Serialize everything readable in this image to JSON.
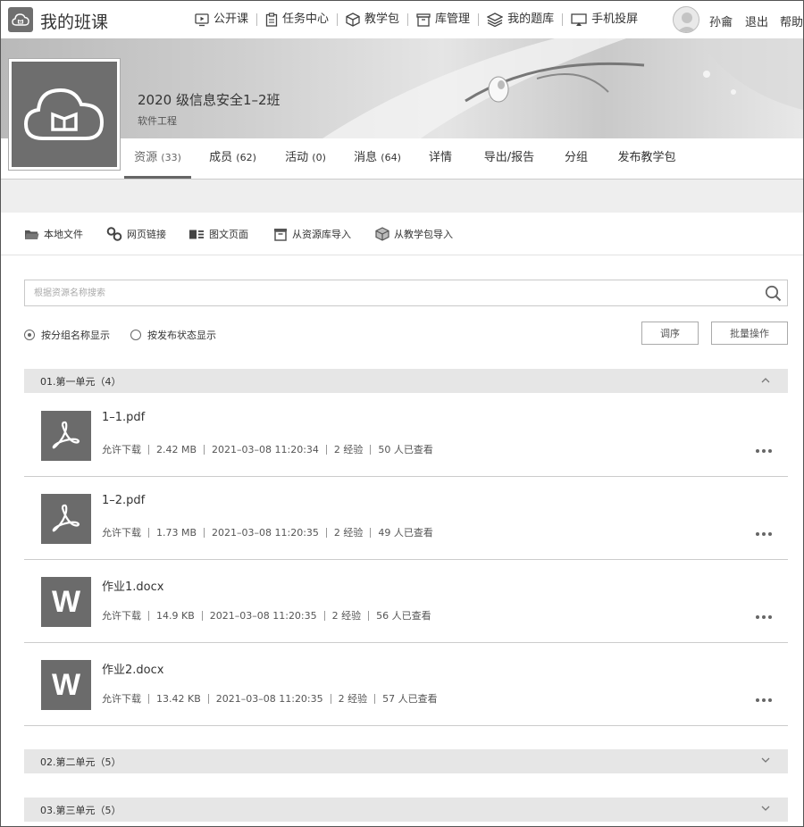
{
  "header": {
    "brand": "我的班课",
    "nav": [
      {
        "label": "公开课",
        "icon": "monitor-play-icon"
      },
      {
        "label": "任务中心",
        "icon": "clipboard-icon"
      },
      {
        "label": "教学包",
        "icon": "package-icon"
      },
      {
        "label": "库管理",
        "icon": "archive-icon"
      },
      {
        "label": "我的题库",
        "icon": "layers-icon"
      },
      {
        "label": "手机投屏",
        "icon": "cast-icon"
      }
    ],
    "user_name": "孙龠",
    "logout": "退出",
    "help": "帮助"
  },
  "class": {
    "title": "2020 级信息安全1–2班",
    "subtitle": "软件工程"
  },
  "tabs": [
    {
      "label": "资源",
      "count": "(33)"
    },
    {
      "label": "成员",
      "count": "(62)"
    },
    {
      "label": "活动",
      "count": "(0)"
    },
    {
      "label": "消息",
      "count": "(64)"
    },
    {
      "label": "详情",
      "count": ""
    },
    {
      "label": "导出/报告",
      "count": ""
    },
    {
      "label": "分组",
      "count": ""
    },
    {
      "label": "发布教学包",
      "count": ""
    }
  ],
  "toolbar": [
    {
      "label": "本地文件",
      "icon": "folder-icon"
    },
    {
      "label": "网页链接",
      "icon": "link-icon"
    },
    {
      "label": "图文页面",
      "icon": "image-text-icon"
    },
    {
      "label": "从资源库导入",
      "icon": "archive-icon"
    },
    {
      "label": "从教学包导入",
      "icon": "package-icon"
    }
  ],
  "search": {
    "placeholder": "根据资源名称搜索"
  },
  "view_options": [
    {
      "label": "按分组名称显示",
      "selected": true
    },
    {
      "label": "按发布状态显示",
      "selected": false
    }
  ],
  "buttons": {
    "reorder": "调序",
    "batch": "批量操作"
  },
  "groups": [
    {
      "label": "01.第一单元（4）",
      "expanded": true
    },
    {
      "label": "02.第二单元（5）",
      "expanded": false
    },
    {
      "label": "03.第三单元（5）",
      "expanded": false
    }
  ],
  "files": [
    {
      "name": "1–1.pdf",
      "type": "pdf",
      "download": "允许下载",
      "size": "2.42 MB",
      "time": "2021–03–08 11:20:34",
      "exp": "2 经验",
      "views": "50 人已查看"
    },
    {
      "name": "1–2.pdf",
      "type": "pdf",
      "download": "允许下载",
      "size": "1.73 MB",
      "time": "2021–03–08 11:20:35",
      "exp": "2 经验",
      "views": "49 人已查看"
    },
    {
      "name": "作业1.docx",
      "type": "word",
      "download": "允许下载",
      "size": "14.9 KB",
      "time": "2021–03–08 11:20:35",
      "exp": "2 经验",
      "views": "56 人已查看"
    },
    {
      "name": "作业2.docx",
      "type": "word",
      "download": "允许下载",
      "size": "13.42 KB",
      "time": "2021–03–08 11:20:35",
      "exp": "2 经验",
      "views": "57 人已查看"
    }
  ],
  "word_icon_letter": "W"
}
